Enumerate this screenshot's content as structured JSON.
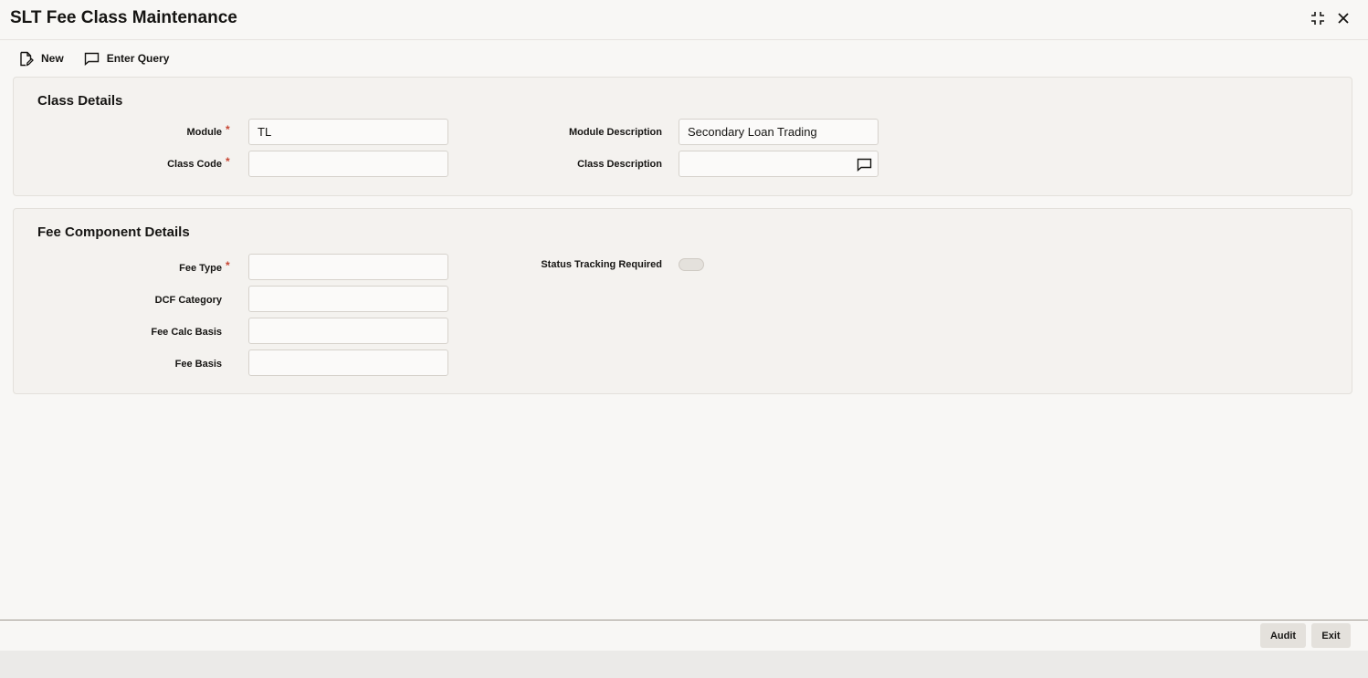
{
  "window": {
    "title": "SLT Fee Class Maintenance",
    "controls": {
      "collapse_icon": "collapse-icon",
      "close_icon": "close-icon"
    }
  },
  "toolbar": {
    "new_label": "New",
    "new_icon": "new-document-icon",
    "enter_query_label": "Enter Query",
    "enter_query_icon": "comment-icon"
  },
  "class_details": {
    "title": "Class Details",
    "module_label": "Module",
    "module_value": "TL",
    "module_required": "*",
    "module_description_label": "Module Description",
    "module_description_value": "Secondary Loan Trading",
    "class_code_label": "Class Code",
    "class_code_value": "",
    "class_code_required": "*",
    "class_description_label": "Class Description",
    "class_description_value": "",
    "class_description_icon": "comment-icon"
  },
  "fee_component_details": {
    "title": "Fee Component Details",
    "fee_type_label": "Fee Type",
    "fee_type_required": "*",
    "fee_type_value": "",
    "dcf_category_label": "DCF Category",
    "dcf_category_value": "",
    "fee_calc_basis_label": "Fee Calc Basis",
    "fee_calc_basis_value": "",
    "fee_basis_label": "Fee Basis",
    "fee_basis_value": "",
    "status_tracking_label": "Status Tracking Required",
    "status_tracking_on": false
  },
  "footer": {
    "audit_label": "Audit",
    "exit_label": "Exit"
  },
  "colors": {
    "background": "#f8f7f5",
    "panel": "#f4f2ef",
    "required": "#c74634",
    "button": "#e4e1dc"
  }
}
